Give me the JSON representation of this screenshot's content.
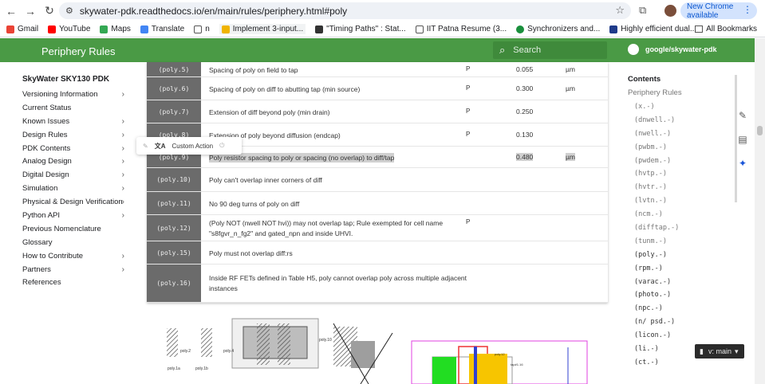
{
  "browser": {
    "url": "skywater-pdk.readthedocs.io/en/main/rules/periphery.html#poly",
    "update_label": "New Chrome available",
    "bookmarks": [
      "Gmail",
      "YouTube",
      "Maps",
      "Translate",
      "n",
      "Implement 3-input...",
      "\"Timing Paths\" : Stat...",
      "IIT Patna Resume (3...",
      "Synchronizers and...",
      "Highly efficient dual..."
    ],
    "all_bookmarks": "All Bookmarks"
  },
  "header": {
    "title": "Periphery Rules",
    "search_placeholder": "Search",
    "repo": "google/skywater-pdk"
  },
  "leftnav": {
    "root": "SkyWater SKY130 PDK",
    "items": [
      {
        "label": "Versioning Information",
        "chev": "›"
      },
      {
        "label": "Current Status",
        "chev": ""
      },
      {
        "label": "Known Issues",
        "chev": "›"
      },
      {
        "label": "Design Rules",
        "chev": "›"
      },
      {
        "label": "PDK Contents",
        "chev": "›"
      },
      {
        "label": "Analog Design",
        "chev": "›"
      },
      {
        "label": "Digital Design",
        "chev": "›"
      },
      {
        "label": "Simulation",
        "chev": "›"
      },
      {
        "label": "Physical & Design Verification",
        "chev": "›"
      },
      {
        "label": "Python API",
        "chev": "›"
      },
      {
        "label": "Previous Nomenclature",
        "chev": ""
      },
      {
        "label": "Glossary",
        "chev": ""
      },
      {
        "label": "How to Contribute",
        "chev": "›"
      },
      {
        "label": "Partners",
        "chev": "›"
      },
      {
        "label": "References",
        "chev": ""
      }
    ]
  },
  "rules": [
    {
      "id": "(poly.5)",
      "desc": "Spacing of poly on field to tap",
      "flag": "P",
      "value": "0.055",
      "unit": "µm"
    },
    {
      "id": "(poly.6)",
      "desc": "Spacing of poly on diff to abutting tap (min source)",
      "flag": "P",
      "value": "0.300",
      "unit": "µm"
    },
    {
      "id": "(poly.7)",
      "desc": "Extension of diff beyond poly (min drain)",
      "flag": "P",
      "value": "0.250",
      "unit": ""
    },
    {
      "id": "(poly.8)",
      "desc": "Extension of poly beyond diffusion (endcap)",
      "flag": "P",
      "value": "0.130",
      "unit": ""
    },
    {
      "id": "(poly.9)",
      "desc": "Poly resistor spacing to poly or spacing (no overlap) to diff/tap",
      "flag": "",
      "value": "0.480",
      "unit": "µm"
    },
    {
      "id": "(poly.10)",
      "desc": "Poly can't overlap inner corners of diff",
      "flag": "",
      "value": "",
      "unit": ""
    },
    {
      "id": "(poly.11)",
      "desc": "No 90 deg turns of poly on diff",
      "flag": "",
      "value": "",
      "unit": ""
    },
    {
      "id": "(poly.12)",
      "desc": "(Poly NOT (nwell NOT hvi)) may not overlap tap; Rule exempted for cell name",
      "desc2": "\"s8fgvr_n_fg2\" and gated_npn and inside UHVI.",
      "flag": "P",
      "value": "",
      "unit": ""
    },
    {
      "id": "(poly.15)",
      "desc": "Poly must not overlap diff:rs",
      "flag": "",
      "value": "",
      "unit": ""
    },
    {
      "id": "(poly.16)",
      "desc": "Inside RF FETs defined in Table H5, poly cannot overlap poly across multiple adjacent",
      "desc2": "instances",
      "flag": "",
      "value": "",
      "unit": ""
    }
  ],
  "floating_toolbar": {
    "action": "Custom Action"
  },
  "toc": {
    "head": "Contents",
    "sub": "Periphery Rules",
    "entries": [
      "(x.-)",
      "(dnwell.-)",
      "(nwell.-)",
      "(pwbm.-)",
      "(pwdem.-)",
      "(hvtp.-)",
      "(hvtr.-)",
      "(lvtn.-)",
      "(ncm.-)",
      "(difftap.-)",
      "(tunm.-)",
      "(poly.-)",
      "(rpm.-)",
      "(varac.-)",
      "(photo.-)",
      "(npc.-)",
      "(n/ psd.-)",
      "(licon.-)",
      "(li.-)",
      "(ct.-)"
    ]
  },
  "version": "v: main",
  "diagram_labels": [
    "poly.1a",
    "poly.2",
    "poly.1b",
    "poly.4",
    "poly.10",
    "poly.12",
    "tap#1.16"
  ]
}
